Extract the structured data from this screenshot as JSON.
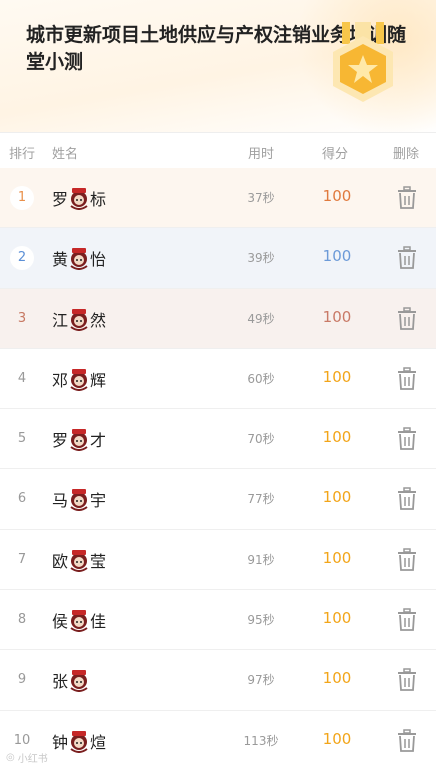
{
  "header": {
    "title": "城市更新项目土地供应与产权注销业务培训随堂小测"
  },
  "columns": {
    "rank": "排行",
    "name": "姓名",
    "time": "用时",
    "score": "得分",
    "delete": "删除"
  },
  "rows": [
    {
      "rank": "1",
      "name_first": "罗",
      "name_last": "标",
      "time": "37秒",
      "score": "100"
    },
    {
      "rank": "2",
      "name_first": "黄",
      "name_last": "怡",
      "time": "39秒",
      "score": "100"
    },
    {
      "rank": "3",
      "name_first": "江",
      "name_last": "然",
      "time": "49秒",
      "score": "100"
    },
    {
      "rank": "4",
      "name_first": "邓",
      "name_last": "辉",
      "time": "60秒",
      "score": "100"
    },
    {
      "rank": "5",
      "name_first": "罗",
      "name_last": "才",
      "time": "70秒",
      "score": "100"
    },
    {
      "rank": "6",
      "name_first": "马",
      "name_last": "宇",
      "time": "77秒",
      "score": "100"
    },
    {
      "rank": "7",
      "name_first": "欧",
      "name_last": "莹",
      "time": "91秒",
      "score": "100"
    },
    {
      "rank": "8",
      "name_first": "侯",
      "name_last": "佳",
      "time": "95秒",
      "score": "100"
    },
    {
      "rank": "9",
      "name_first": "张",
      "name_last": "",
      "time": "97秒",
      "score": "100"
    },
    {
      "rank": "10",
      "name_first": "钟",
      "name_last": "煊",
      "time": "113秒",
      "score": "100"
    }
  ],
  "watermark": {
    "text": "小红书"
  },
  "icons": {
    "medal": "medal-star-icon",
    "delete": "trash-icon",
    "mask": "sticker-mask-icon"
  },
  "colors": {
    "gold": "#f2a519",
    "rank1": "#e07a3e",
    "rank2": "#6c9ad8",
    "rank3": "#c97a67"
  }
}
